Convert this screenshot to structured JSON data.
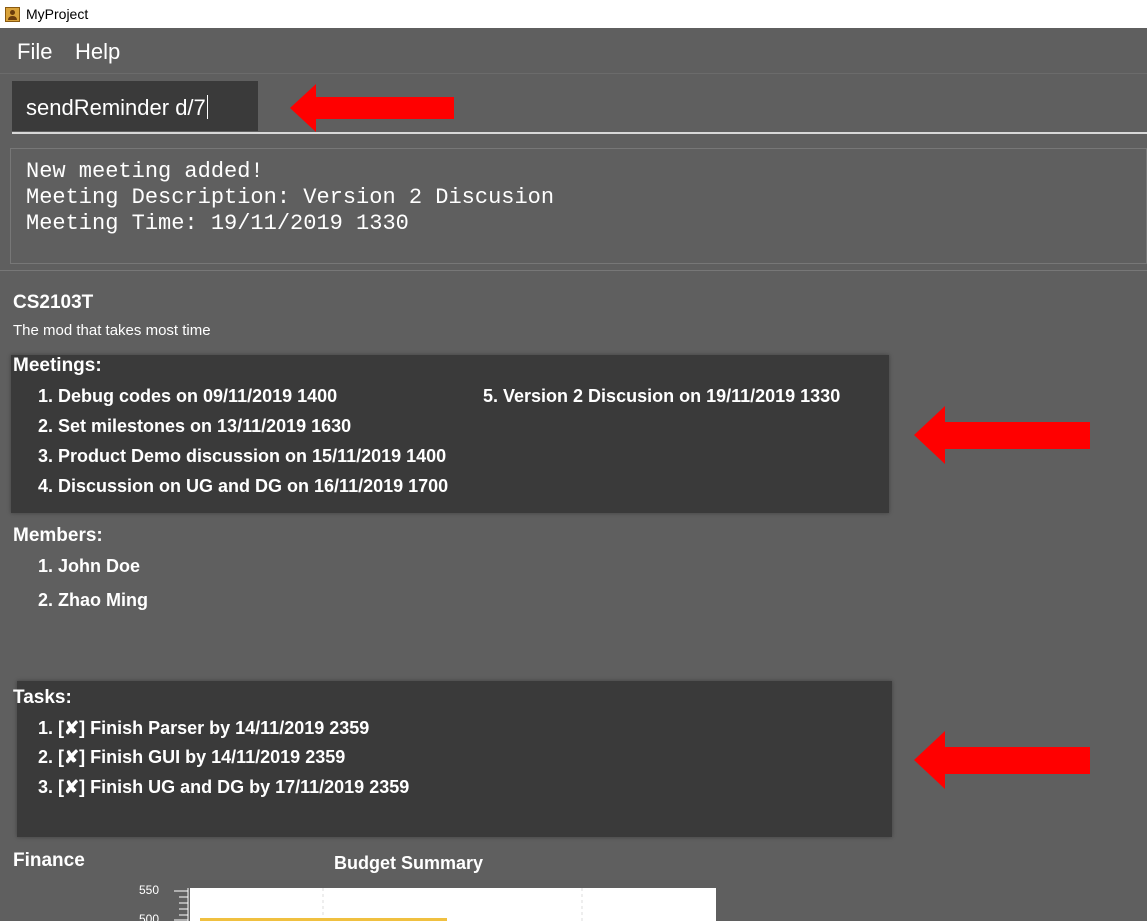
{
  "window": {
    "title": "MyProject"
  },
  "menu": {
    "file": "File",
    "help": "Help"
  },
  "command": {
    "value": "sendReminder d/7"
  },
  "result": {
    "lines": [
      "New meeting added!",
      "Meeting Description: Version 2 Discusion",
      "Meeting Time: 19/11/2019 1330"
    ]
  },
  "project": {
    "name": "CS2103T",
    "description": "The mod that takes most time"
  },
  "meetings": {
    "heading": "Meetings:",
    "items": [
      "1. Debug codes on 09/11/2019 1400",
      "2. Set milestones on 13/11/2019 1630",
      "3. Product Demo discussion on 15/11/2019 1400",
      "4. Discussion on UG and DG on 16/11/2019 1700",
      "5. Version 2 Discusion on 19/11/2019 1330"
    ]
  },
  "members": {
    "heading": "Members:",
    "items": [
      "1. John Doe",
      "2. Zhao Ming"
    ]
  },
  "tasks": {
    "heading": "Tasks:",
    "items": [
      "1. [✘] Finish Parser by 14/11/2019 2359",
      "2. [✘] Finish GUI by 14/11/2019 2359",
      "3. [✘] Finish UG and DG by 17/11/2019 2359"
    ]
  },
  "finance": {
    "heading": "Finance",
    "chart_title": "Budget Summary",
    "y_ticks": [
      "550",
      "500"
    ]
  },
  "colors": {
    "background": "#5f5f5f",
    "panel": "#3a3a3a",
    "annotation_arrow": "#ff0000"
  }
}
